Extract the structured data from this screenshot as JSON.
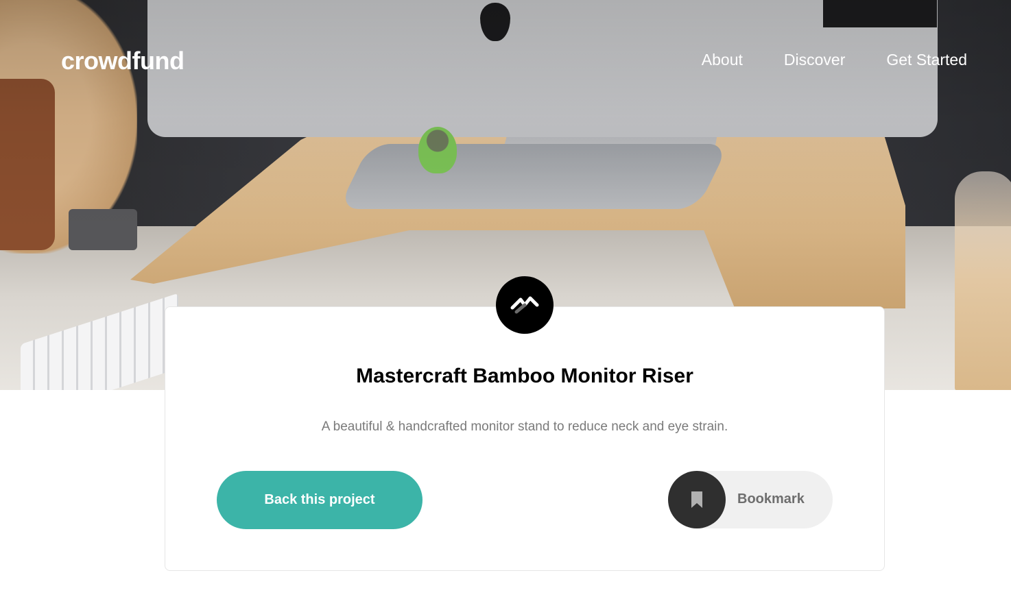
{
  "header": {
    "logo": "crowdfund",
    "nav": [
      "About",
      "Discover",
      "Get Started"
    ]
  },
  "project": {
    "brand_icon": "mastercraft-logo-icon",
    "title": "Mastercraft Bamboo Monitor Riser",
    "description": "A beautiful & handcrafted monitor stand to reduce neck and eye strain.",
    "back_label": "Back this project",
    "bookmark_label": "Bookmark",
    "bookmark_icon": "bookmark-icon"
  },
  "colors": {
    "accent": "#3cb4a8",
    "dark": "#2f2f2f",
    "text_muted": "#7a7a7a"
  }
}
